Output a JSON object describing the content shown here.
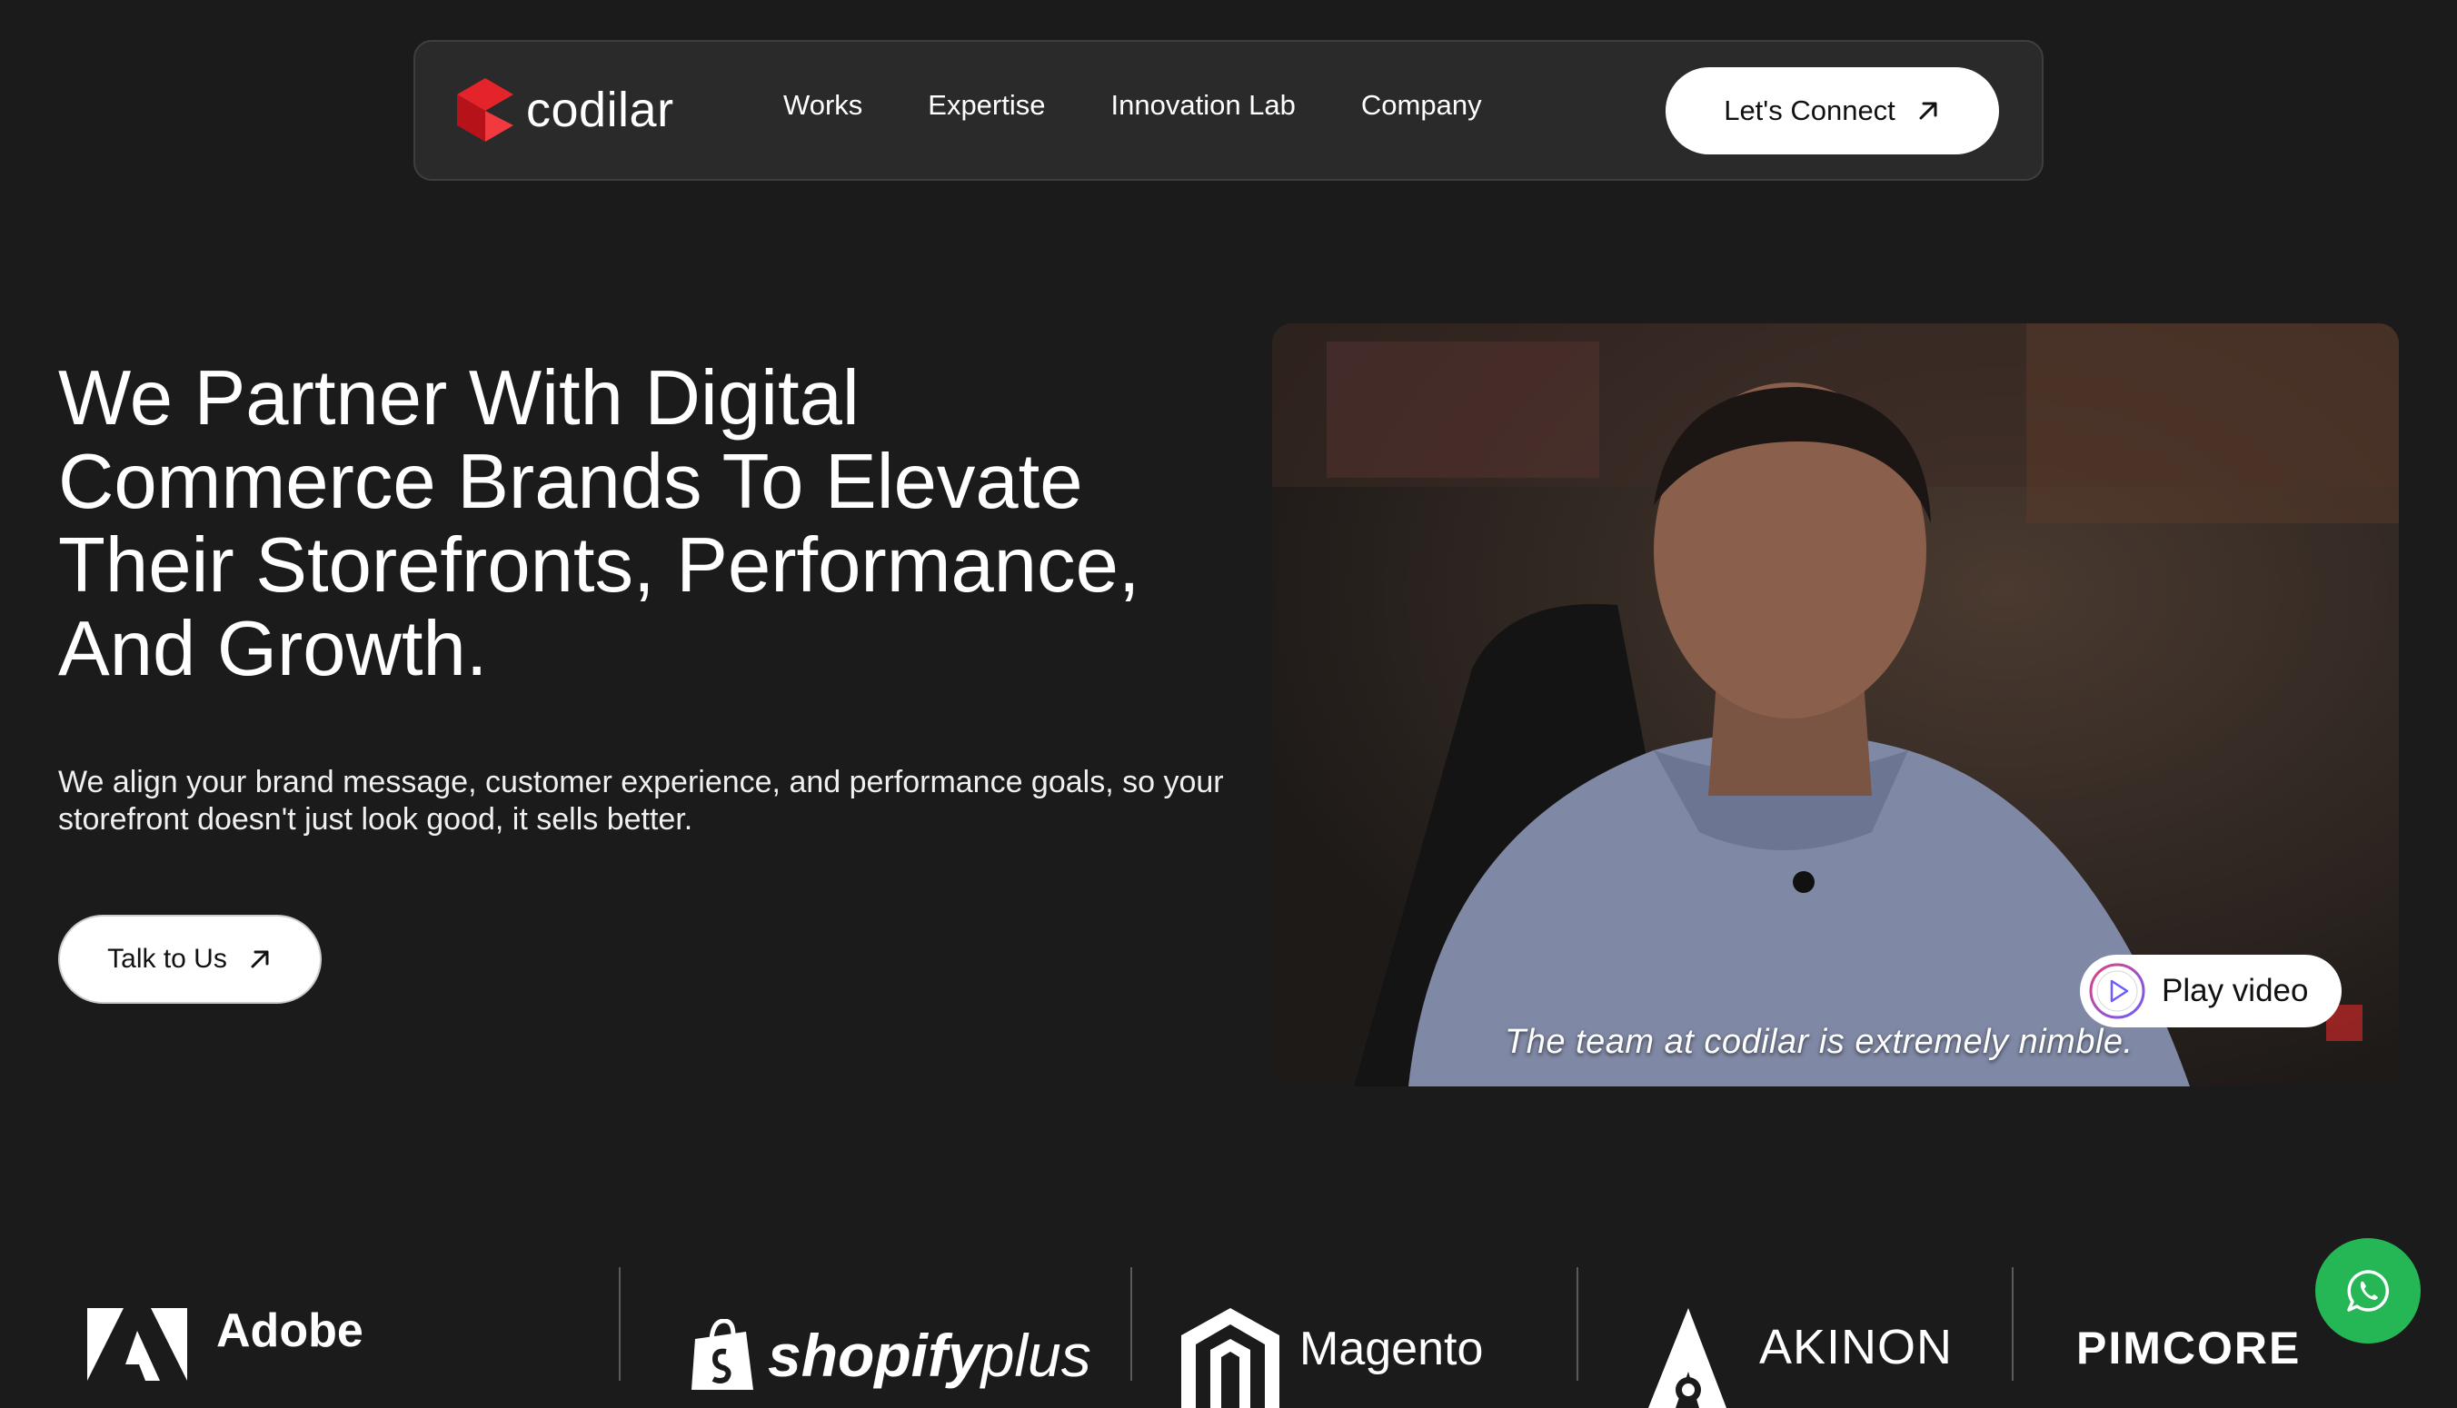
{
  "nav": {
    "logo_text": "codilar",
    "links": [
      "Works",
      "Expertise",
      "Innovation Lab",
      "Company"
    ],
    "cta_label": "Let's Connect"
  },
  "hero": {
    "title": "We Partner With Digital Commerce Brands To Elevate Their Storefronts, Performance, And Growth.",
    "subtitle": "We align your brand message, customer experience, and performance goals, so your storefront doesn't just look good, it sells better.",
    "cta_label": "Talk to Us"
  },
  "video": {
    "caption": "The team at codilar is extremely nimble.",
    "play_label": "Play video"
  },
  "partners": {
    "adobe": "Adobe",
    "shopify": "shopify",
    "shopify_suffix": "plus",
    "magento": "Magento",
    "akinon": "AKINON",
    "pimcore": "PIMCORE"
  },
  "colors": {
    "background": "#1b1b1b",
    "nav_background": "#2a2a2a",
    "logo_red": "#e4232b",
    "whatsapp_green": "#25b755",
    "button_white": "#ffffff"
  },
  "icons": {
    "logo": "codilar-logo-icon",
    "cta_arrow": "arrow-up-right-icon",
    "play": "play-circle-icon",
    "whatsapp": "whatsapp-icon"
  }
}
